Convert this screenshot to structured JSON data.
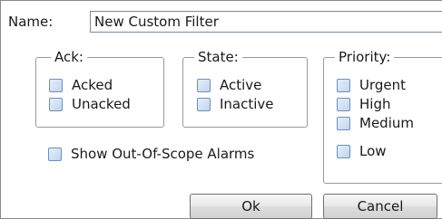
{
  "name_field": {
    "label": "Name:",
    "value": "New Custom Filter"
  },
  "ack_group": {
    "legend": "Ack:",
    "options": [
      {
        "label": "Acked",
        "checked": false
      },
      {
        "label": "Unacked",
        "checked": false
      }
    ]
  },
  "state_group": {
    "legend": "State:",
    "options": [
      {
        "label": "Active",
        "checked": false
      },
      {
        "label": "Inactive",
        "checked": false
      }
    ]
  },
  "priority_group": {
    "legend": "Priority:",
    "options": [
      {
        "label": "Urgent",
        "checked": false
      },
      {
        "label": "High",
        "checked": false
      },
      {
        "label": "Medium",
        "checked": false
      },
      {
        "label": "Low",
        "checked": false
      }
    ]
  },
  "out_of_scope": {
    "label": "Show Out-Of-Scope Alarms",
    "checked": false
  },
  "buttons": {
    "ok_label": "Ok",
    "cancel_label": "Cancel"
  },
  "colors": {
    "checkbox_border": "#6f8fb8",
    "checkbox_fill": "#c2d4ee",
    "group_border": "#9a9a9a"
  }
}
